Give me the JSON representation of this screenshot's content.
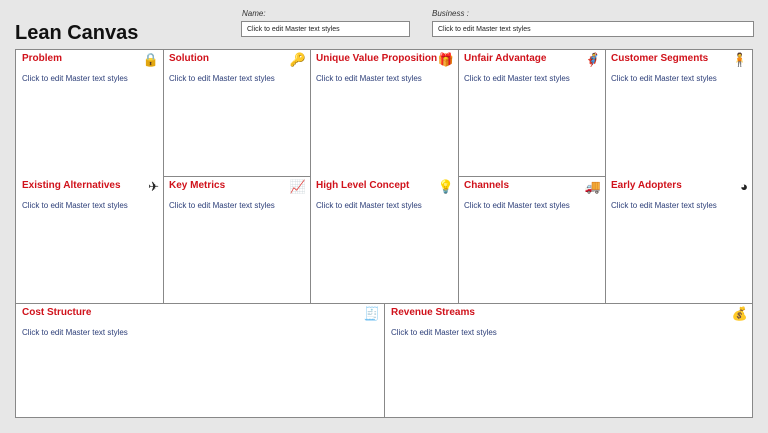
{
  "title": "Lean Canvas",
  "name_label": "Name:",
  "name_value": "Click to edit Master text styles",
  "business_label": "Business :",
  "business_value": "Click to edit Master text styles",
  "cells": [
    {
      "title": "Problem",
      "text": "Click to edit Master text styles",
      "icon": "🔒"
    },
    {
      "title": "Solution",
      "text": "Click to edit Master text styles",
      "icon": "🔑"
    },
    {
      "title": "Unique Value Proposition",
      "text": "Click to edit Master text styles",
      "icon": "🎁"
    },
    {
      "title": "Unfair Advantage",
      "text": "Click to edit Master text styles",
      "icon": "🦸"
    },
    {
      "title": "Customer Segments",
      "text": "Click to edit Master text styles",
      "icon": "🧍"
    },
    {
      "title": "Existing Alternatives",
      "text": "Click to edit Master text styles",
      "icon": "✈"
    },
    {
      "title": "Key Metrics",
      "text": "Click to edit Master text styles",
      "icon": "📈"
    },
    {
      "title": "High Level Concept",
      "text": "Click to edit Master text styles",
      "icon": "💡"
    },
    {
      "title": "Channels",
      "text": "Click to edit Master text styles",
      "icon": "🚚"
    },
    {
      "title": "Early Adopters",
      "text": "Click to edit Master text styles",
      "icon": "◕"
    },
    {
      "title": "Cost Structure",
      "text": "Click to edit Master text styles",
      "icon": "🧾"
    },
    {
      "title": "Revenue Streams",
      "text": "Click to edit Master text styles",
      "icon": "💰"
    }
  ]
}
